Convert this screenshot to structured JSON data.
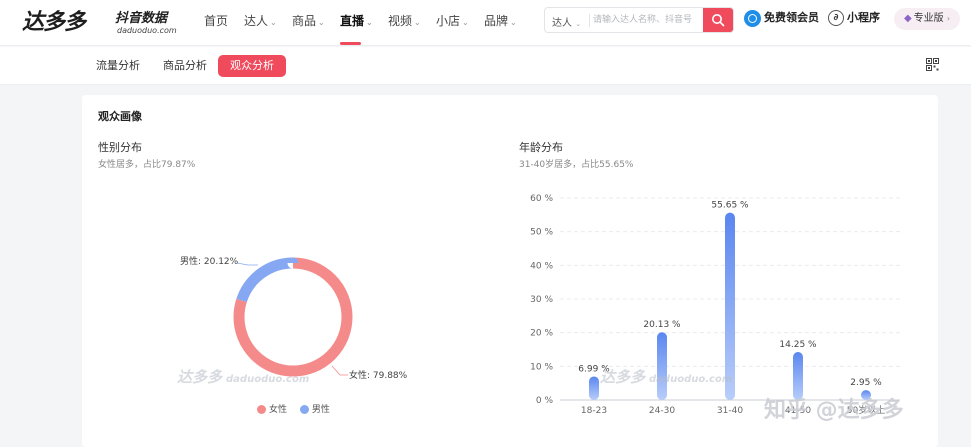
{
  "brand": {
    "logo": "达多多",
    "subtitle": "抖音数据",
    "domain": "daduoduo.com"
  },
  "nav": [
    {
      "label": "首页",
      "dropdown": false,
      "active": false
    },
    {
      "label": "达人",
      "dropdown": true,
      "active": false
    },
    {
      "label": "商品",
      "dropdown": true,
      "active": false
    },
    {
      "label": "直播",
      "dropdown": true,
      "active": true
    },
    {
      "label": "视频",
      "dropdown": true,
      "active": false
    },
    {
      "label": "小店",
      "dropdown": true,
      "active": false
    },
    {
      "label": "品牌",
      "dropdown": true,
      "active": false
    }
  ],
  "search": {
    "type_label": "达人",
    "placeholder": "请输入达人名称、抖音号"
  },
  "header_actions": {
    "vip": "免费领会员",
    "mini_program": "小程序",
    "pro": "专业版"
  },
  "subnav": {
    "tabs": [
      {
        "label": "流量分析",
        "active": false
      },
      {
        "label": "商品分析",
        "active": false
      },
      {
        "label": "观众分析",
        "active": true
      }
    ]
  },
  "card": {
    "title": "观众画像"
  },
  "gender": {
    "title": "性别分布",
    "subtitle": "女性居多，占比79.87%",
    "female_label": "女性: 79.88%",
    "male_label": "男性: 20.12%",
    "legend": [
      "女性",
      "男性"
    ],
    "colors": {
      "female": "#f58a8a",
      "male": "#86a8f2"
    }
  },
  "age": {
    "title": "年龄分布",
    "subtitle": "31-40岁居多，占比55.65%"
  },
  "watermark": {
    "logo": "达多多",
    "domain": "daduoduo.com"
  },
  "zhihu_watermark": "知乎 @达多多",
  "chart_data": [
    {
      "type": "pie",
      "title": "性别分布",
      "categories": [
        "女性",
        "男性"
      ],
      "values": [
        79.88,
        20.12
      ],
      "unit": "%"
    },
    {
      "type": "bar",
      "title": "年龄分布",
      "categories": [
        "18-23",
        "24-30",
        "31-40",
        "41-50",
        "50岁以上"
      ],
      "values": [
        6.99,
        20.13,
        55.65,
        14.25,
        2.95
      ],
      "data_labels": [
        "6.99 %",
        "20.13 %",
        "55.65 %",
        "14.25 %",
        "2.95 %"
      ],
      "y_ticks": [
        "0 %",
        "10 %",
        "20 %",
        "30 %",
        "40 %",
        "50 %",
        "60 %"
      ],
      "ylim": [
        0,
        60
      ],
      "unit": "%",
      "grid": true
    }
  ]
}
